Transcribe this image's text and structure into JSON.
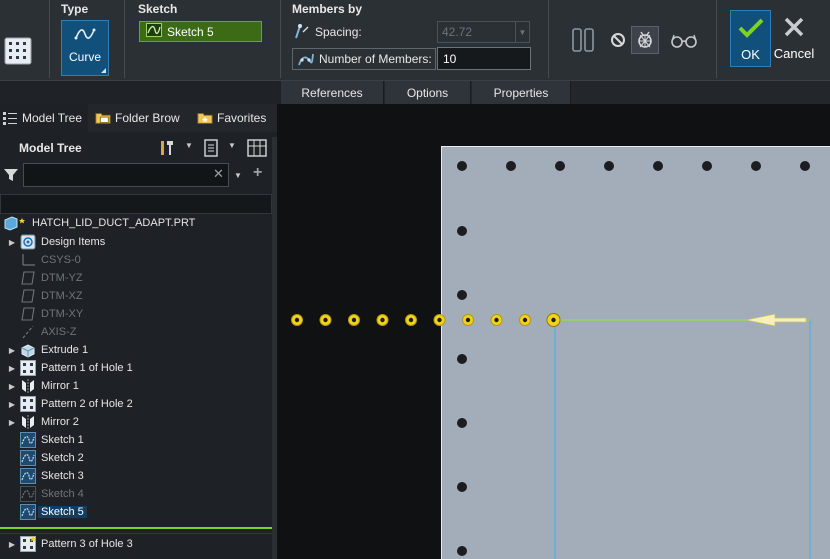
{
  "ribbon": {
    "type_title": "Type",
    "type_button_label": "Curve",
    "sketch_title": "Sketch",
    "sketch_value": "Sketch 5",
    "members_by_title": "Members by",
    "spacing_label": "Spacing:",
    "spacing_value": "42.72",
    "number_of_members_label": "Number of Members:",
    "number_of_members_value": "10",
    "ok_label": "OK",
    "cancel_label": "Cancel"
  },
  "dashboard_tabs": [
    "References",
    "Options",
    "Properties"
  ],
  "nav_tabs": [
    "Model Tree",
    "Folder Brow",
    "Favorites"
  ],
  "model_tree": {
    "title": "Model Tree",
    "filter_placeholder": "",
    "root": "HATCH_LID_DUCT_ADAPT.PRT",
    "items": [
      {
        "label": "Design Items",
        "icon": "design-items-icon",
        "expandable": true,
        "dim": false,
        "selected": false
      },
      {
        "label": "CSYS-0",
        "icon": "csys-icon",
        "expandable": false,
        "dim": true,
        "selected": false
      },
      {
        "label": "DTM-YZ",
        "icon": "datum-plane-icon",
        "expandable": false,
        "dim": true,
        "selected": false
      },
      {
        "label": "DTM-XZ",
        "icon": "datum-plane-icon",
        "expandable": false,
        "dim": true,
        "selected": false
      },
      {
        "label": "DTM-XY",
        "icon": "datum-plane-icon",
        "expandable": false,
        "dim": true,
        "selected": false
      },
      {
        "label": "AXIS-Z",
        "icon": "axis-icon",
        "expandable": false,
        "dim": true,
        "selected": false
      },
      {
        "label": "Extrude 1",
        "icon": "extrude-icon",
        "expandable": true,
        "dim": false,
        "selected": false
      },
      {
        "label": "Pattern 1 of Hole 1",
        "icon": "pattern-icon",
        "expandable": true,
        "dim": false,
        "selected": false
      },
      {
        "label": "Mirror 1",
        "icon": "mirror-icon",
        "expandable": true,
        "dim": false,
        "selected": false
      },
      {
        "label": "Pattern 2 of Hole 2",
        "icon": "pattern-icon",
        "expandable": true,
        "dim": false,
        "selected": false
      },
      {
        "label": "Mirror 2",
        "icon": "mirror-icon",
        "expandable": true,
        "dim": false,
        "selected": false
      },
      {
        "label": "Sketch 1",
        "icon": "sketch-icon",
        "expandable": false,
        "dim": false,
        "selected": false
      },
      {
        "label": "Sketch 2",
        "icon": "sketch-icon",
        "expandable": false,
        "dim": false,
        "selected": false
      },
      {
        "label": "Sketch 3",
        "icon": "sketch-icon",
        "expandable": false,
        "dim": false,
        "selected": false
      },
      {
        "label": "Sketch 4",
        "icon": "sketch-icon",
        "expandable": false,
        "dim": true,
        "selected": false
      },
      {
        "label": "Sketch 5",
        "icon": "sketch-icon",
        "expandable": false,
        "dim": false,
        "selected": true
      }
    ],
    "bottom_item": "Pattern 3 of Hole 3"
  },
  "colors": {
    "accent": "#11507a",
    "sketch_green": "#3d6a15",
    "insert_line": "#7ed321",
    "part_surface": "#a3adba",
    "preview_marker": "#f2d21b"
  }
}
